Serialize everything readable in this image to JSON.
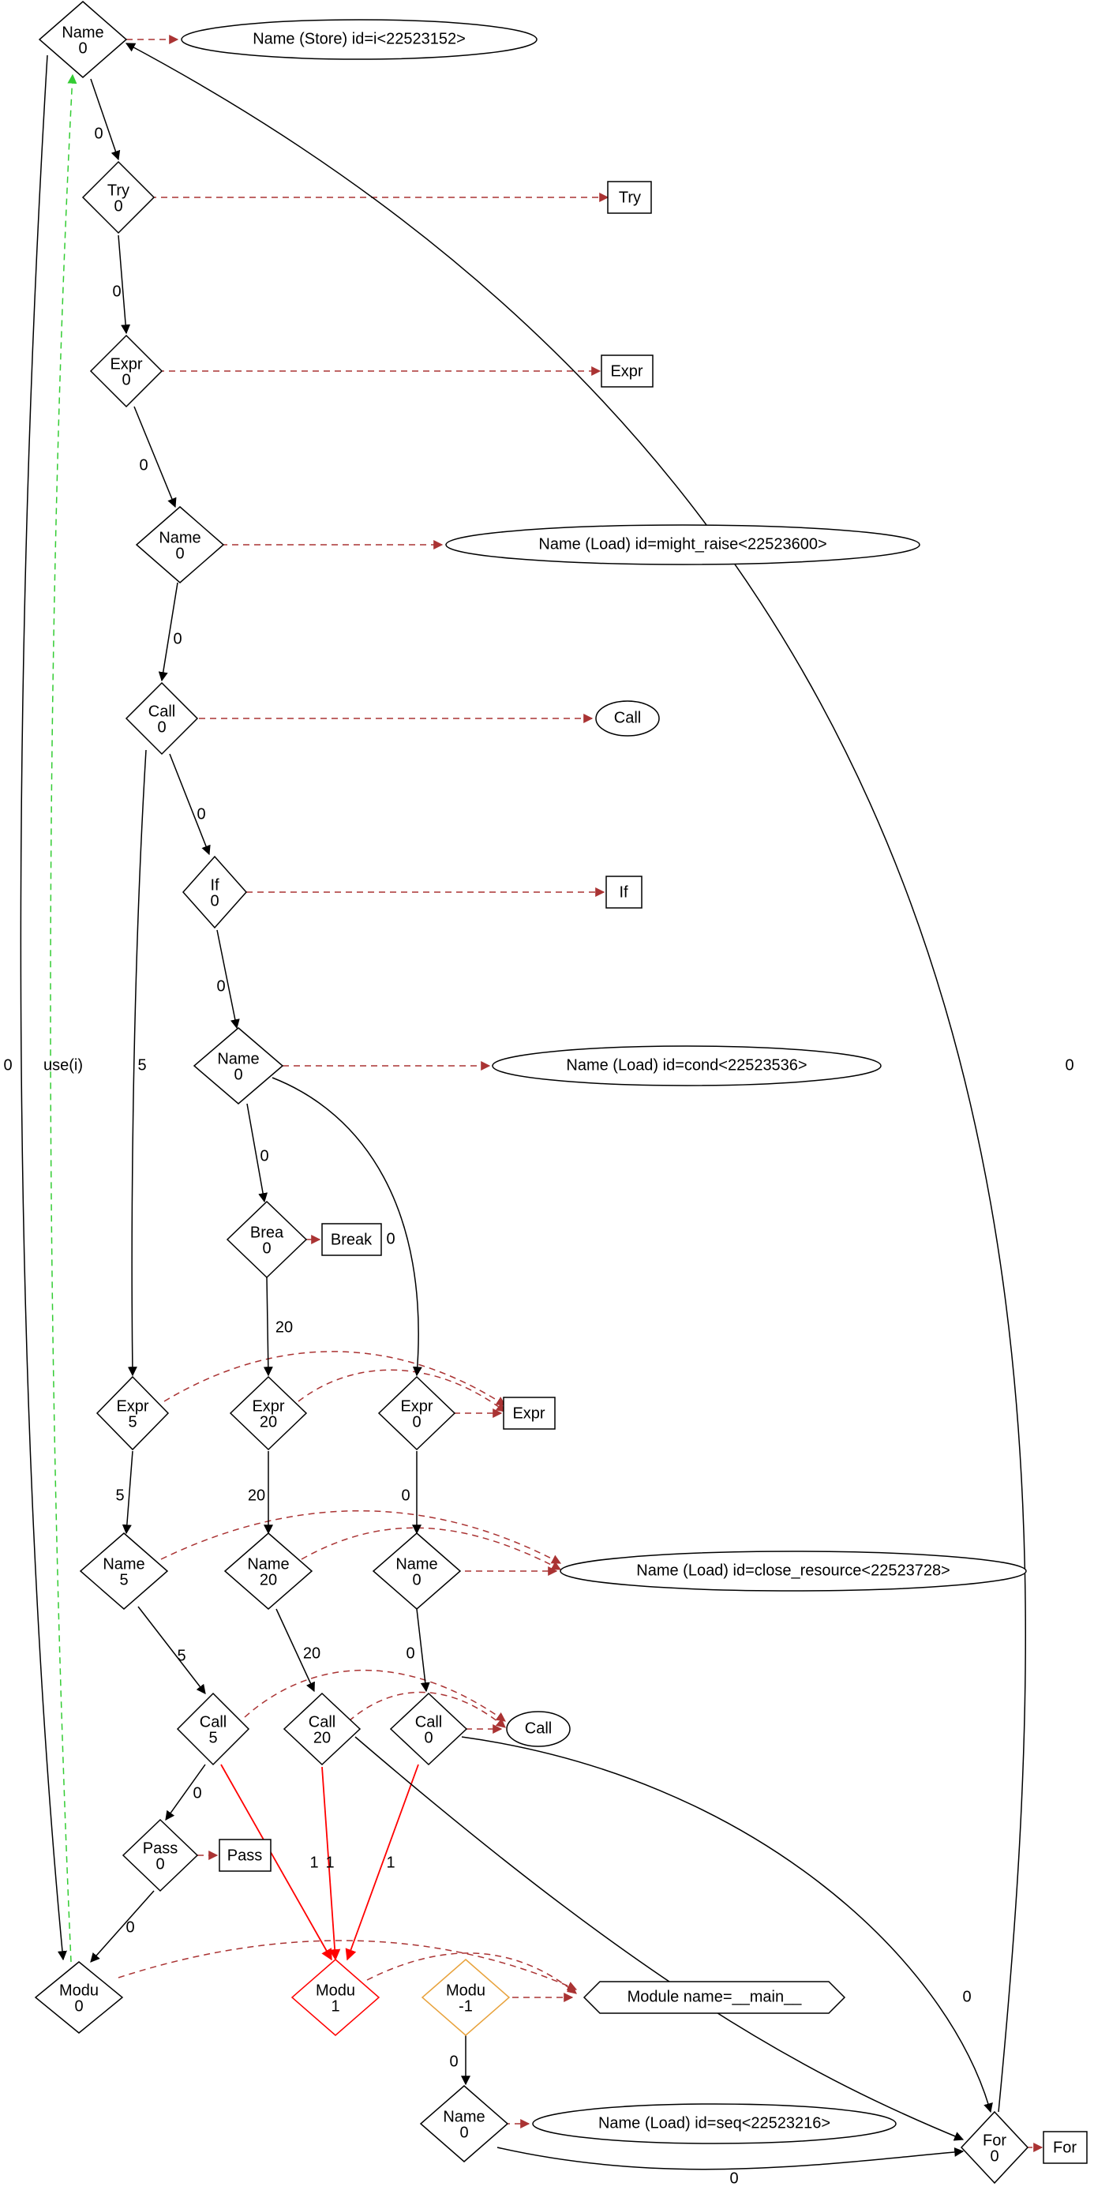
{
  "nodes": {
    "name_top": {
      "l1": "Name",
      "l2": "0"
    },
    "try": {
      "l1": "Try",
      "l2": "0"
    },
    "expr1": {
      "l1": "Expr",
      "l2": "0"
    },
    "name_mr": {
      "l1": "Name",
      "l2": "0"
    },
    "call1": {
      "l1": "Call",
      "l2": "0"
    },
    "if": {
      "l1": "If",
      "l2": "0"
    },
    "name_cond": {
      "l1": "Name",
      "l2": "0"
    },
    "brea": {
      "l1": "Brea",
      "l2": "0"
    },
    "expr5": {
      "l1": "Expr",
      "l2": "5"
    },
    "expr20": {
      "l1": "Expr",
      "l2": "20"
    },
    "expr0b": {
      "l1": "Expr",
      "l2": "0"
    },
    "name5": {
      "l1": "Name",
      "l2": "5"
    },
    "name20": {
      "l1": "Name",
      "l2": "20"
    },
    "name0b": {
      "l1": "Name",
      "l2": "0"
    },
    "call5": {
      "l1": "Call",
      "l2": "5"
    },
    "call20": {
      "l1": "Call",
      "l2": "20"
    },
    "call0b": {
      "l1": "Call",
      "l2": "0"
    },
    "pass": {
      "l1": "Pass",
      "l2": "0"
    },
    "modu0": {
      "l1": "Modu",
      "l2": "0"
    },
    "modu1": {
      "l1": "Modu",
      "l2": "1"
    },
    "modu_m1": {
      "l1": "Modu",
      "l2": "-1"
    },
    "name_seq": {
      "l1": "Name",
      "l2": "0"
    },
    "for": {
      "l1": "For",
      "l2": "0"
    }
  },
  "labels": {
    "name_store": "Name (Store) id=i<22523152>",
    "try": "Try",
    "expr": "Expr",
    "name_mr": "Name (Load) id=might_raise<22523600>",
    "call": "Call",
    "if": "If",
    "name_cond": "Name (Load) id=cond<22523536>",
    "break": "Break",
    "expr2": "Expr",
    "name_close": "Name (Load) id=close_resource<22523728>",
    "call2": "Call",
    "pass": "Pass",
    "module": "Module name=__main__",
    "name_seq": "Name (Load) id=seq<22523216>",
    "for": "For"
  },
  "edge_labels": {
    "use_i": "use(i)",
    "e0": "0",
    "e5": "5",
    "e20": "20",
    "e1": "1"
  }
}
